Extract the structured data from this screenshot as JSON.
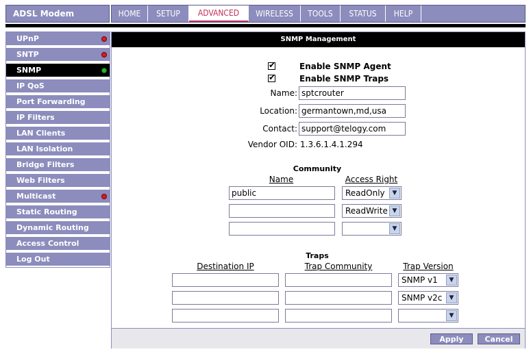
{
  "brand": {
    "title": "ADSL Modem"
  },
  "nav": {
    "tabs": [
      {
        "label": "HOME"
      },
      {
        "label": "SETUP"
      },
      {
        "label": "ADVANCED"
      },
      {
        "label": "WIRELESS"
      },
      {
        "label": "TOOLS"
      },
      {
        "label": "STATUS"
      },
      {
        "label": "HELP"
      }
    ],
    "active_tab": "ADVANCED"
  },
  "sidebar": {
    "items": [
      {
        "label": "UPnP",
        "status": "red"
      },
      {
        "label": "SNTP",
        "status": "red"
      },
      {
        "label": "SNMP",
        "status": "green",
        "active": true
      },
      {
        "label": "IP QoS"
      },
      {
        "label": "Port Forwarding"
      },
      {
        "label": "IP Filters"
      },
      {
        "label": "LAN Clients"
      },
      {
        "label": "LAN Isolation"
      },
      {
        "label": "Bridge Filters"
      },
      {
        "label": "Web Filters"
      },
      {
        "label": "Multicast",
        "status": "red"
      },
      {
        "label": "Static Routing"
      },
      {
        "label": "Dynamic Routing"
      },
      {
        "label": "Access Control"
      },
      {
        "label": "Log Out"
      }
    ]
  },
  "main": {
    "header": "SNMP Management",
    "enable_agent": {
      "label": "Enable SNMP Agent",
      "checked": true
    },
    "enable_traps": {
      "label": "Enable SNMP Traps",
      "checked": true
    },
    "fields": {
      "name_label": "Name:",
      "name_value": "sptcrouter",
      "location_label": "Location:",
      "location_value": "germantown,md,usa",
      "contact_label": "Contact:",
      "contact_value": "support@telogy.com",
      "vendor_label": "Vendor OID:",
      "vendor_value": "1.3.6.1.4.1.294"
    },
    "community": {
      "title": "Community",
      "col_name": "Name",
      "col_access": "Access Right",
      "rows": [
        {
          "name": "public",
          "access": "ReadOnly"
        },
        {
          "name": "",
          "access": "ReadWrite"
        },
        {
          "name": "",
          "access": ""
        }
      ]
    },
    "traps": {
      "title": "Traps",
      "col_dest": "Destination IP",
      "col_community": "Trap Community",
      "col_version": "Trap Version",
      "rows": [
        {
          "dest": "",
          "community": "",
          "version": "SNMP v1"
        },
        {
          "dest": "",
          "community": "",
          "version": "SNMP v2c"
        },
        {
          "dest": "",
          "community": "",
          "version": ""
        }
      ]
    },
    "buttons": {
      "apply": "Apply",
      "cancel": "Cancel"
    }
  },
  "colors": {
    "nav_bg": "#8c8cbd",
    "active_tab_text": "#c0305a",
    "status_red": "#d02020",
    "status_green": "#30b030"
  },
  "icons": {
    "status_indicator": "status-dot-icon",
    "checkbox": "checkmark-icon",
    "dropdown": "chevron-down-icon"
  }
}
